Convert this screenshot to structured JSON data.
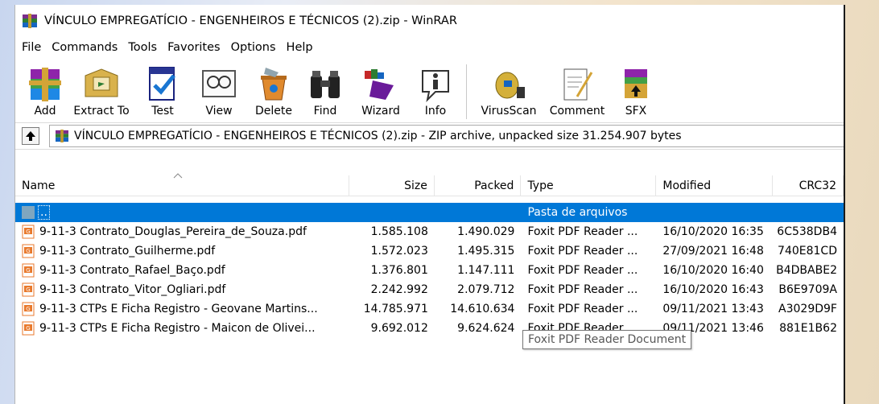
{
  "window": {
    "title": "VÍNCULO EMPREGATÍCIO - ENGENHEIROS E TÉCNICOS (2).zip - WinRAR"
  },
  "menu": [
    "File",
    "Commands",
    "Tools",
    "Favorites",
    "Options",
    "Help"
  ],
  "toolbar": [
    {
      "label": "Add",
      "icon": "add-archive-icon"
    },
    {
      "label": "Extract To",
      "icon": "extract-to-icon"
    },
    {
      "label": "Test",
      "icon": "test-icon"
    },
    {
      "label": "View",
      "icon": "view-icon"
    },
    {
      "label": "Delete",
      "icon": "delete-icon"
    },
    {
      "label": "Find",
      "icon": "find-binoculars-icon"
    },
    {
      "label": "Wizard",
      "icon": "wizard-icon"
    },
    {
      "label": "Info",
      "icon": "info-icon"
    },
    {
      "label": "VirusScan",
      "icon": "virusscan-icon"
    },
    {
      "label": "Comment",
      "icon": "comment-icon"
    },
    {
      "label": "SFX",
      "icon": "sfx-icon"
    }
  ],
  "address": {
    "text": "VÍNCULO EMPREGATÍCIO - ENGENHEIROS E TÉCNICOS (2).zip - ZIP archive, unpacked size 31.254.907 bytes"
  },
  "columns": {
    "name": "Name",
    "size": "Size",
    "packed": "Packed",
    "type": "Type",
    "modified": "Modified",
    "crc": "CRC32"
  },
  "parent_row": {
    "name": "..",
    "type": "Pasta de arquivos"
  },
  "files": [
    {
      "name": "9-11-3 Contrato_Douglas_Pereira_de_Souza.pdf",
      "size": "1.585.108",
      "packed": "1.490.029",
      "type": "Foxit PDF Reader ...",
      "modified": "16/10/2020 16:35",
      "crc": "6C538DB4"
    },
    {
      "name": "9-11-3 Contrato_Guilherme.pdf",
      "size": "1.572.023",
      "packed": "1.495.315",
      "type": "Foxit PDF Reader ...",
      "modified": "27/09/2021 16:48",
      "crc": "740E81CD"
    },
    {
      "name": "9-11-3 Contrato_Rafael_Baço.pdf",
      "size": "1.376.801",
      "packed": "1.147.111",
      "type": "Foxit PDF Reader ...",
      "modified": "16/10/2020 16:40",
      "crc": "B4DBABE2"
    },
    {
      "name": "9-11-3 Contrato_Vitor_Ogliari.pdf",
      "size": "2.242.992",
      "packed": "2.079.712",
      "type": "Foxit PDF Reader ...",
      "modified": "16/10/2020 16:43",
      "crc": "B6E9709A"
    },
    {
      "name": "9-11-3 CTPs E Ficha Registro - Geovane Martins...",
      "size": "14.785.971",
      "packed": "14.610.634",
      "type": "Foxit PDF Reader ...",
      "modified": "09/11/2021 13:43",
      "crc": "A3029D9F"
    },
    {
      "name": "9-11-3 CTPs E Ficha Registro - Maicon de Olivei...",
      "size": "9.692.012",
      "packed": "9.624.624",
      "type": "Foxit PDF Reader ...",
      "modified": "09/11/2021 13:46",
      "crc": "881E1B62"
    }
  ],
  "tooltip": "Foxit PDF Reader Document",
  "colors": {
    "selection": "#0078d7",
    "pdf_icon": "#e8792c"
  }
}
